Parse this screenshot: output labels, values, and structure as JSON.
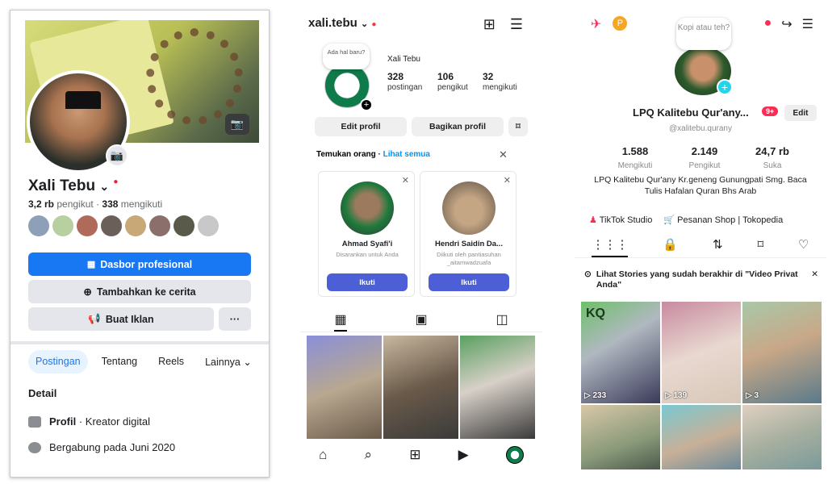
{
  "facebook": {
    "name": "Xali Tebu",
    "followers_count": "3,2 rb",
    "followers_label": "pengikut",
    "following_count": "338",
    "following_label": "mengikuti",
    "professional_dashboard": "Dasbor profesional",
    "add_story": "Tambahkan ke cerita",
    "create_ad": "Buat Iklan",
    "more": "···",
    "tabs": [
      "Postingan",
      "Tentang",
      "Reels",
      "Lainnya ⌄"
    ],
    "detail_title": "Detail",
    "profile_label": "Profil",
    "profile_value": " · Kreator digital",
    "joined": "Bergabung pada Juni 2020",
    "colors": {
      "accent": "#1877f2",
      "button_gray": "#e4e6eb"
    }
  },
  "instagram": {
    "username": "xali.tebu",
    "note": "Ada hal baru?",
    "display_name": "Xali Tebu",
    "stats": [
      {
        "n": "328",
        "l": "postingan"
      },
      {
        "n": "106",
        "l": "pengikut"
      },
      {
        "n": "32",
        "l": "mengikuti"
      }
    ],
    "edit_profile": "Edit profil",
    "share_profile": "Bagikan profil",
    "discover_title": "Temukan orang",
    "see_all": "Lihat semua",
    "suggestions": [
      {
        "name": "Ahmad Syafi'i",
        "sub": "Disarankan untuk Anda",
        "follow": "Ikuti"
      },
      {
        "name": "Hendri Saidin Da...",
        "sub": "Diikuti oleh pantiasuhan _aitamwadzuafa",
        "follow": "Ikuti"
      }
    ],
    "colors": {
      "follow": "#4c5fd7",
      "link": "#0095f6"
    }
  },
  "tiktok": {
    "note": "Kopi atau teh?",
    "name": "LPQ Kalitebu Qur'any...",
    "badge": "9+",
    "edit": "Edit",
    "handle": "@xalitebu.qurany",
    "stats": [
      {
        "n": "1.588",
        "l": "Mengikuti"
      },
      {
        "n": "2.149",
        "l": "Pengikut"
      },
      {
        "n": "24,7 rb",
        "l": "Suka"
      }
    ],
    "bio": "LPQ Kalitebu Qur'any Kr.geneng Gunungpati Smg. Baca Tulis Hafalan Quran Bhs Arab",
    "tiktok_studio": "TikTok Studio",
    "shop_orders": "Pesanan Shop | Tokopedia",
    "stories_notice": "Lihat Stories yang sudah berakhir di \"Video Privat Anda\"",
    "video_counts": [
      "▷ 233",
      "▷ 139",
      "▷ 3"
    ],
    "thumb_label": "KQ",
    "colors": {
      "accent": "#fe2c55",
      "plus": "#20d5ec"
    }
  }
}
